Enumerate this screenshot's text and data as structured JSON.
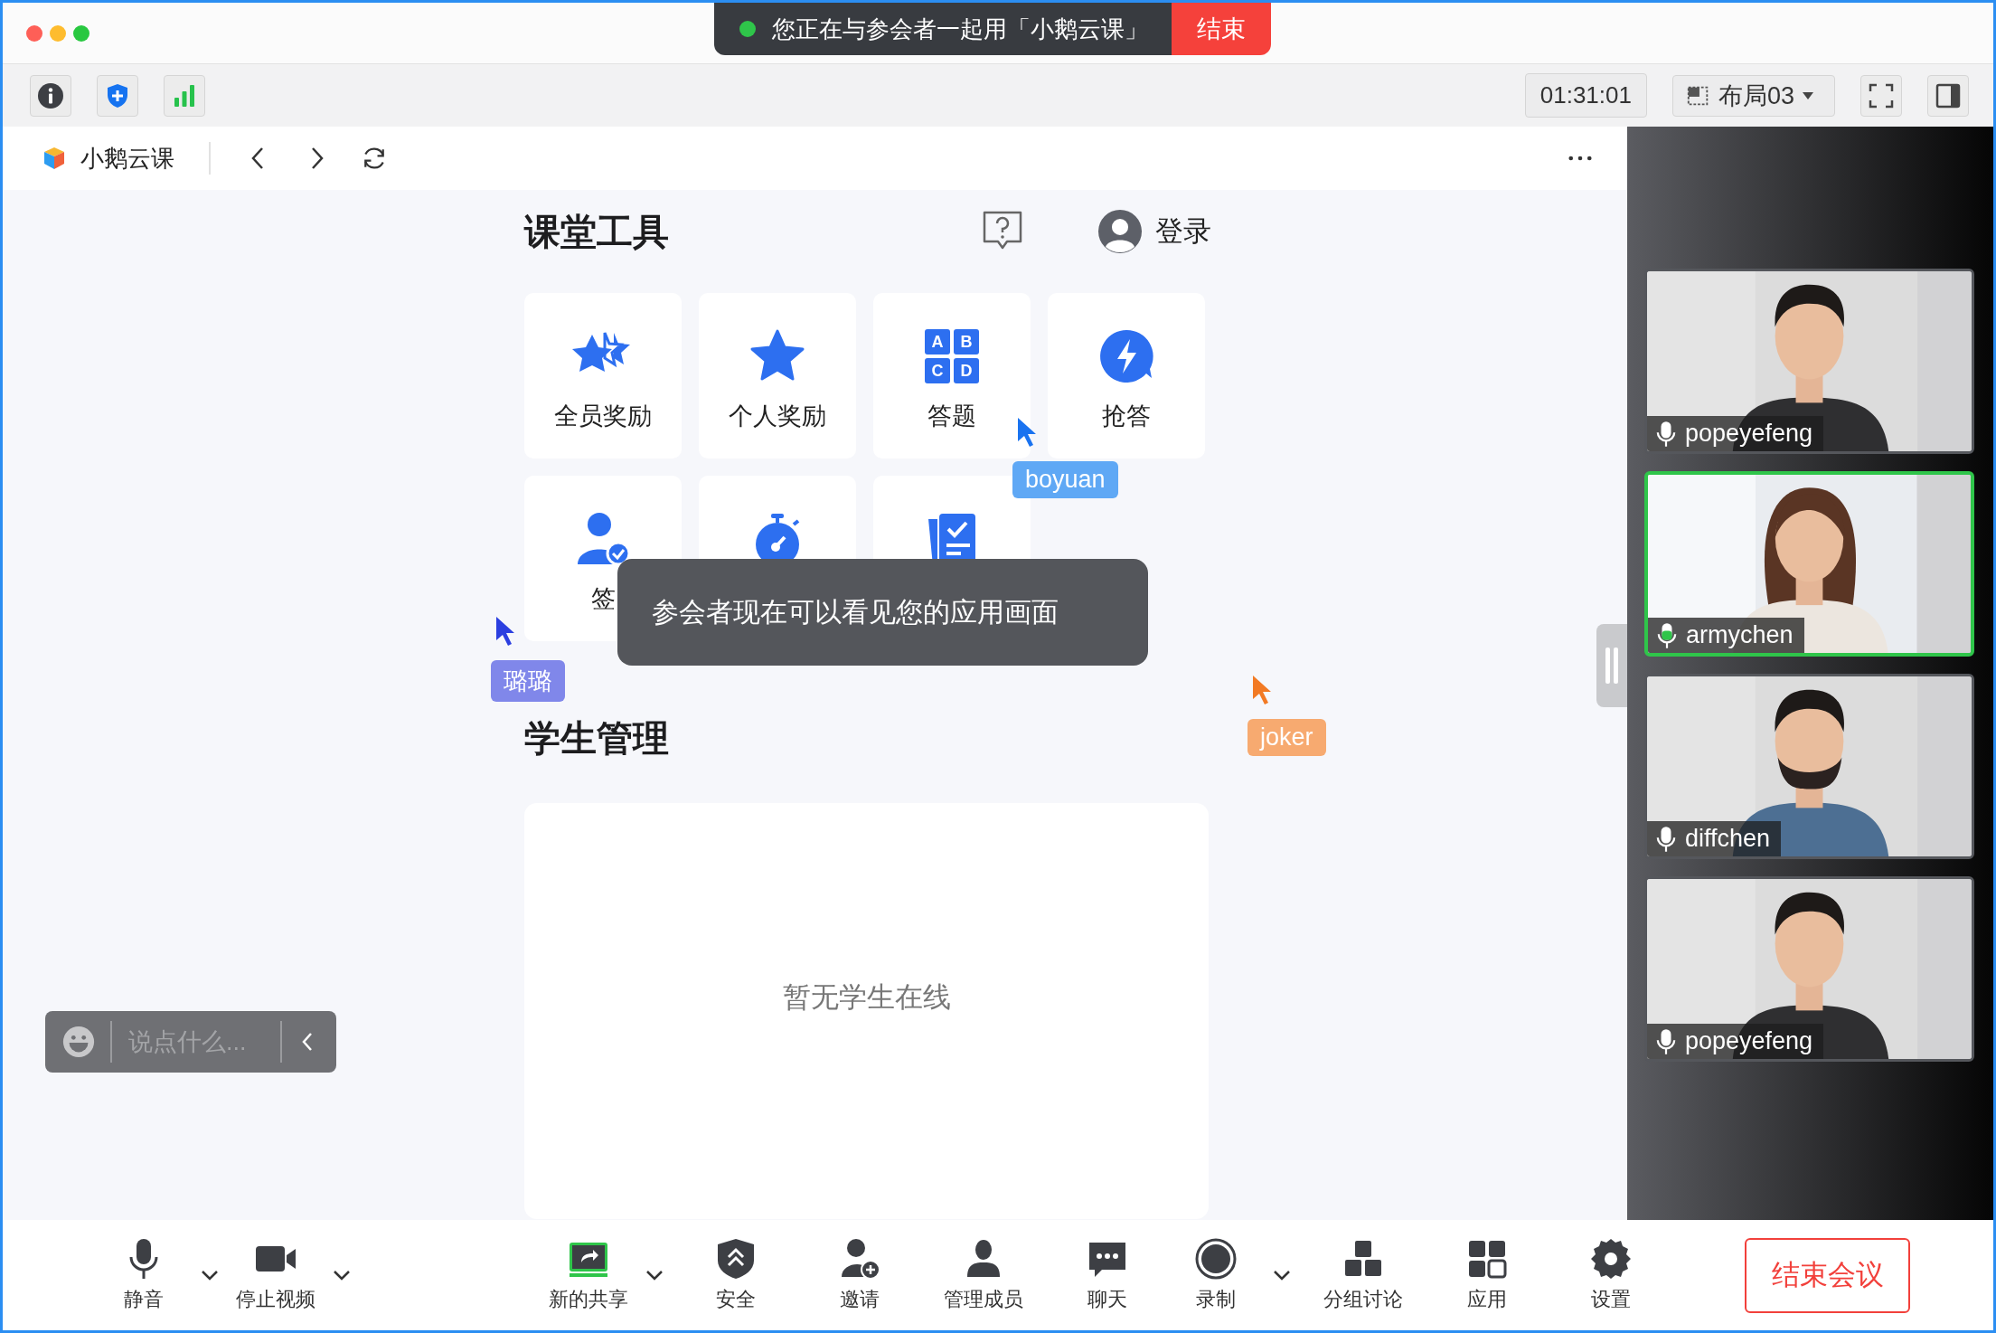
{
  "share_banner": {
    "text": "您正在与参会者一起用「小鹅云课」",
    "end_button": "结束"
  },
  "toolbar": {
    "timer": "01:31:01",
    "layout": "布局03"
  },
  "browser": {
    "app_name": "小鹅云课"
  },
  "tools_section": {
    "title": "课堂工具",
    "login": "登录",
    "tools": [
      {
        "label": "全员奖励",
        "kind": "stars"
      },
      {
        "label": "个人奖励",
        "kind": "star"
      },
      {
        "label": "答题",
        "kind": "abcd",
        "glyphs": [
          "A",
          "B",
          "C",
          "D"
        ]
      },
      {
        "label": "抢答",
        "kind": "bolt"
      },
      {
        "label": "签",
        "kind": "signin"
      },
      {
        "kind": "timer"
      },
      {
        "kind": "homework"
      }
    ]
  },
  "toast": "参会者现在可以看见您的应用画面",
  "cursors": [
    {
      "name": "boyuan",
      "color": "#5fa8f5"
    },
    {
      "name": "璐璐",
      "color": "#8087ea"
    },
    {
      "name": "joker",
      "color": "#f7aa70"
    }
  ],
  "students_section": {
    "title": "学生管理",
    "empty_text": "暂无学生在线"
  },
  "chat": {
    "placeholder": "说点什么..."
  },
  "participants": [
    {
      "name": "popeyefeng",
      "speaking": false
    },
    {
      "name": "armychen",
      "speaking": true
    },
    {
      "name": "diffchen",
      "speaking": false
    },
    {
      "name": "popeyefeng",
      "speaking": false
    }
  ],
  "bottom_bar": {
    "items": [
      {
        "label": "静音",
        "kind": "mic",
        "dropdown": true
      },
      {
        "label": "停止视频",
        "kind": "video",
        "dropdown": true
      },
      {
        "label": "新的共享",
        "kind": "share",
        "dropdown": true
      },
      {
        "label": "安全",
        "kind": "security",
        "dropdown": false
      },
      {
        "label": "邀请",
        "kind": "invite",
        "dropdown": false
      },
      {
        "label": "管理成员",
        "kind": "members",
        "dropdown": false
      },
      {
        "label": "聊天",
        "kind": "chat",
        "dropdown": false
      },
      {
        "label": "录制",
        "kind": "record",
        "dropdown": true
      },
      {
        "label": "分组讨论",
        "kind": "breakout",
        "dropdown": false
      },
      {
        "label": "应用",
        "kind": "apps",
        "dropdown": false
      },
      {
        "label": "设置",
        "kind": "settings",
        "dropdown": false
      }
    ],
    "end_button": "结束会议"
  }
}
